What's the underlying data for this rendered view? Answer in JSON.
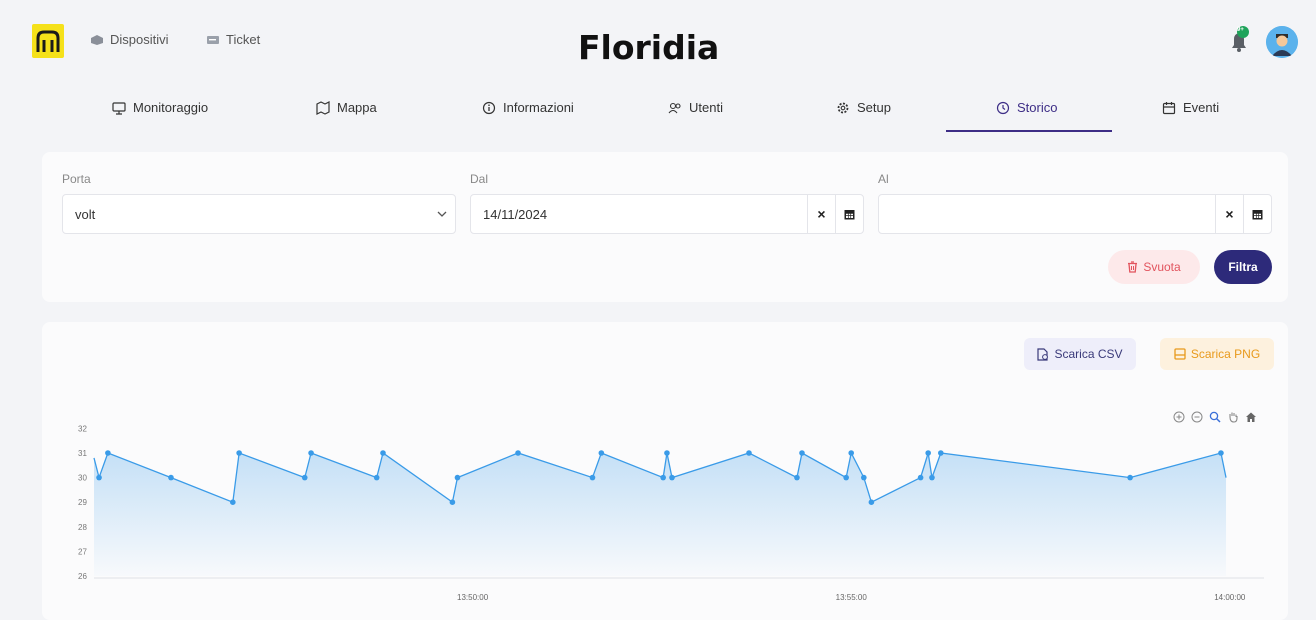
{
  "header": {
    "title": "Floridia",
    "nav": [
      {
        "label": "Dispositivi",
        "icon": "cube-icon"
      },
      {
        "label": "Ticket",
        "icon": "ticket-icon"
      }
    ],
    "notification_badge": "9+"
  },
  "tabs": [
    {
      "label": "Monitoraggio",
      "icon": "monitor-icon"
    },
    {
      "label": "Mappa",
      "icon": "map-icon"
    },
    {
      "label": "Informazioni",
      "icon": "info-icon"
    },
    {
      "label": "Utenti",
      "icon": "users-icon"
    },
    {
      "label": "Setup",
      "icon": "gear-icon"
    },
    {
      "label": "Storico",
      "icon": "history-icon",
      "active": true
    },
    {
      "label": "Eventi",
      "icon": "calendar-icon"
    }
  ],
  "filters": {
    "porta_label": "Porta",
    "porta_value": "volt",
    "dal_label": "Dal",
    "dal_value": "14/11/2024",
    "al_label": "Al",
    "al_value": "",
    "clear_glyph": "×",
    "svuota_label": "Svuota",
    "filtra_label": "Filtra"
  },
  "chart_toolbar": {
    "csv_label": "Scarica CSV",
    "png_label": "Scarica PNG"
  },
  "colors": {
    "accent": "#2d2a7a",
    "series": "#3a9be8",
    "danger": "#e2545e",
    "warning": "#e89a1c"
  },
  "chart_data": {
    "type": "area",
    "ylim": [
      26,
      32
    ],
    "yticks": [
      "32",
      "31",
      "30",
      "29",
      "28",
      "27",
      "26"
    ],
    "xticks": [
      "13:50:00",
      "13:55:00",
      "14:00:00"
    ],
    "xticks_seconds": [
      300,
      600,
      900
    ],
    "x_seconds": [
      4,
      11,
      61,
      110,
      115,
      167,
      172,
      224,
      229,
      284,
      288,
      336,
      395,
      402,
      451,
      454,
      458,
      519,
      557,
      561,
      596,
      600,
      610,
      616,
      655,
      661,
      664,
      671,
      821,
      893
    ],
    "y": [
      30,
      31,
      30,
      29,
      31,
      30,
      31,
      30,
      31,
      29,
      30,
      31,
      30,
      31,
      30,
      31,
      30,
      31,
      30,
      31,
      30,
      31,
      30,
      29,
      30,
      31,
      30,
      31,
      30,
      31
    ],
    "line_x_seconds": [
      0,
      4,
      11,
      61,
      110,
      115,
      167,
      172,
      224,
      229,
      284,
      288,
      336,
      395,
      402,
      451,
      454,
      458,
      519,
      557,
      561,
      596,
      600,
      610,
      616,
      655,
      661,
      664,
      671,
      821,
      893,
      897
    ],
    "line_y": [
      30.8,
      30,
      31,
      30,
      29,
      31,
      30,
      31,
      30,
      31,
      29,
      30,
      31,
      30,
      31,
      30,
      31,
      30,
      31,
      30,
      31,
      30,
      31,
      30,
      29,
      30,
      31,
      30,
      31,
      30,
      31,
      30
    ],
    "grid": true
  }
}
